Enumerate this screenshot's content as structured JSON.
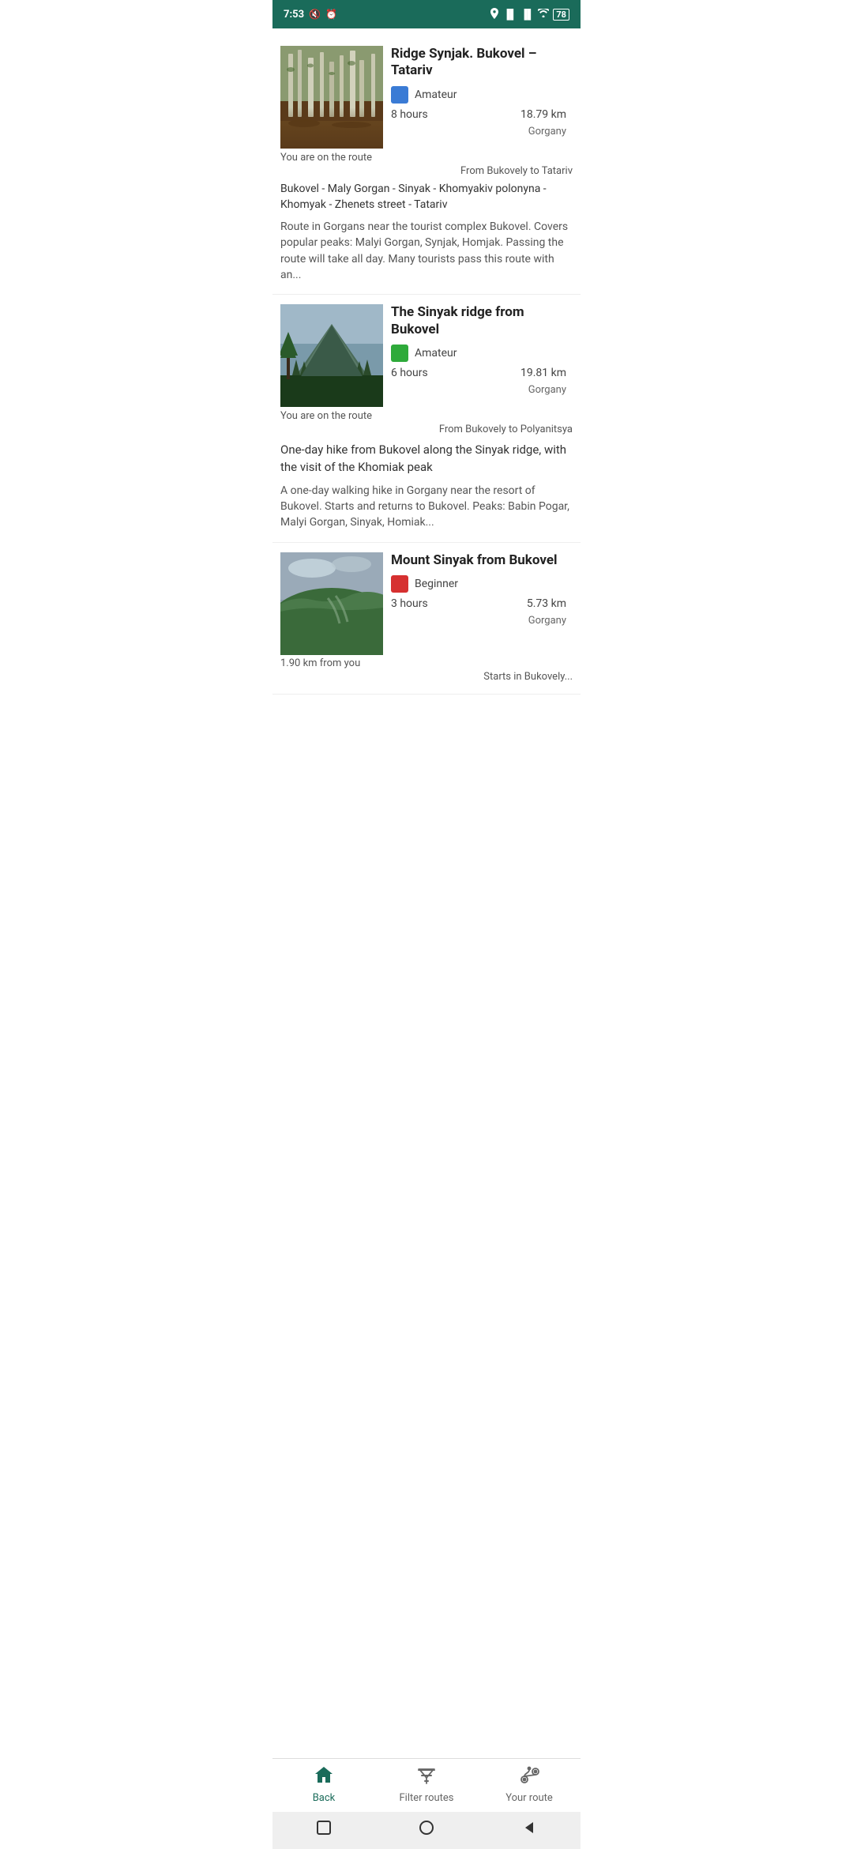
{
  "statusBar": {
    "time": "7:53",
    "icons": [
      "muted",
      "alarm",
      "location",
      "signal1",
      "signal2",
      "wifi",
      "battery"
    ],
    "battery": "78"
  },
  "routes": [
    {
      "id": 1,
      "title": "Ridge Synjak. Bukovel – Tatariv",
      "difficulty": "Amateur",
      "difficultyColor": "#3a7bd5",
      "hours": "8 hours",
      "distance": "18.79 km",
      "region": "Gorgany",
      "status": "You are on the route",
      "from": "From Bukovely to Tatariv",
      "waypoints": "Bukovel - Maly Gorgan - Sinyak - Khomyakiv polonyna - Khomyak - Zhenets street - Tatariv",
      "description": "Route in Gorgans near the tourist complex Bukovel. Covers popular peaks: Malyi Gorgan, Synjak, Homjak. Passing the route will take all day. Many tourists pass this route with an...",
      "imgType": "forest"
    },
    {
      "id": 2,
      "title": "The Sinyak ridge from Bukovel",
      "difficulty": "Amateur",
      "difficultyColor": "#2eaa3a",
      "hours": "6 hours",
      "distance": "19.81 km",
      "region": "Gorgany",
      "status": "You are on the route",
      "from": "From Bukovely to Polyanitsya",
      "waypoints": "",
      "description": "One-day hike from Bukovel along the Sinyak ridge, with the visit of the Khomiak peak",
      "description2": "A one-day walking hike in Gorgany near the resort of Bukovel. Starts and returns to Bukovel. Peaks: Babin Pogar, Malyi Gorgan, Sinyak, Homiak...",
      "imgType": "mountain"
    },
    {
      "id": 3,
      "title": "Mount Sinyak from Bukovel",
      "difficulty": "Beginner",
      "difficultyColor": "#d63030",
      "hours": "3 hours",
      "distance": "5.73 km",
      "region": "Gorgany",
      "distanceFromYou": "1.90 km from you",
      "from": "Starts in Bukovely...",
      "imgType": "landscape"
    }
  ],
  "bottomNav": {
    "items": [
      {
        "id": "back",
        "label": "Back",
        "icon": "house",
        "active": true
      },
      {
        "id": "filter",
        "label": "Filter routes",
        "icon": "filter",
        "active": false
      },
      {
        "id": "your-route",
        "label": "Your route",
        "icon": "route",
        "active": false
      }
    ]
  },
  "sysNav": {
    "buttons": [
      "square",
      "circle",
      "triangle-left"
    ]
  }
}
